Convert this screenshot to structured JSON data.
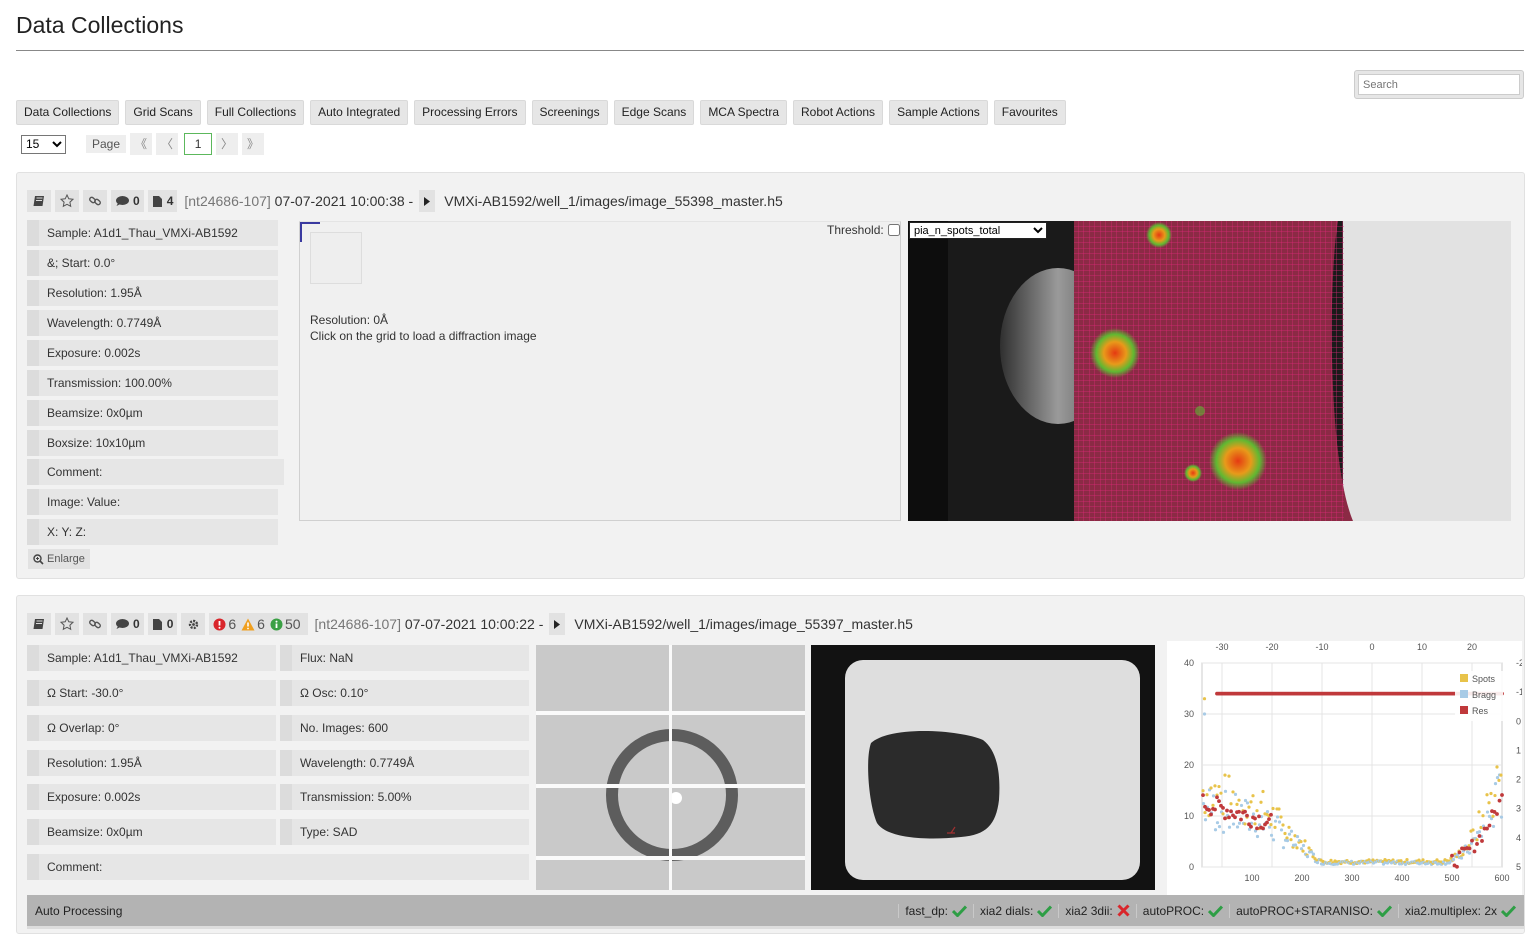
{
  "page": {
    "title": "Data Collections"
  },
  "search": {
    "placeholder": "Search"
  },
  "tabs": [
    "Data Collections",
    "Grid Scans",
    "Full Collections",
    "Auto Integrated",
    "Processing Errors",
    "Screenings",
    "Edge Scans",
    "MCA Spectra",
    "Robot Actions",
    "Sample Actions",
    "Favourites"
  ],
  "pagination": {
    "per_page": "15",
    "label": "Page",
    "first": "《",
    "prev": "〈",
    "current": "1",
    "next": "〉",
    "last": "》"
  },
  "dc1": {
    "comments": "0",
    "attachments": "4",
    "prop": "[nt24686-107]",
    "datetime": "07-07-2021 10:00:38 -",
    "path": "VMXi-AB1592/well_1/images/image_55398_master.h5",
    "fields": [
      "Sample: A1d1_Thau_VMXi-AB1592",
      "&; Start: 0.0°",
      "Resolution: 1.95Å",
      "Wavelength: 0.7749Å",
      "Exposure: 0.002s",
      "Transmission: 100.00%",
      "Beamsize: 0x0µm",
      "Boxsize: 10x10µm",
      "Comment:",
      "Image: Value:",
      "X: Y: Z:"
    ],
    "enlarge": "Enlarge",
    "diff_resolution": "Resolution: 0Å",
    "diff_hint": "Click on the grid to load a diffraction image",
    "threshold_label": "Threshold:",
    "grid_metric": "pia_n_spots_total"
  },
  "dc2": {
    "comments": "0",
    "attachments": "0",
    "errors": "6",
    "warnings": "6",
    "info": "50",
    "prop": "[nt24686-107]",
    "datetime": "07-07-2021 10:00:22 -",
    "path": "VMXi-AB1592/well_1/images/image_55397_master.h5",
    "fields_left": [
      "Sample: A1d1_Thau_VMXi-AB1592",
      "Ω Start: -30.0°",
      "Ω Overlap: 0°",
      "Resolution: 1.95Å",
      "Exposure: 0.002s",
      "Beamsize: 0x0µm",
      "Comment:"
    ],
    "fields_right": [
      "Flux: NaN",
      "Ω Osc: 0.10°",
      "No. Images: 600",
      "Wavelength: 0.7749Å",
      "Transmission: 5.00%",
      "Type: SAD"
    ],
    "auto_processing": {
      "title": "Auto Processing",
      "pipelines": [
        {
          "name": "fast_dp:",
          "status": "ok"
        },
        {
          "name": "xia2 dials:",
          "status": "ok"
        },
        {
          "name": "xia2 3dii:",
          "status": "fail"
        },
        {
          "name": "autoPROC:",
          "status": "ok"
        },
        {
          "name": "autoPROC+STARANISO:",
          "status": "ok"
        },
        {
          "name": "xia2.multiplex: 2x",
          "status": "ok"
        }
      ]
    }
  },
  "chart_data": {
    "type": "scatter",
    "x_top_ticks": [
      "-30",
      "-20",
      "-10",
      "0",
      "10",
      "20"
    ],
    "x_bottom_ticks": [
      "100",
      "200",
      "300",
      "400",
      "500",
      "600"
    ],
    "y_left_ticks": [
      "0",
      "10",
      "20",
      "30",
      "40"
    ],
    "y_right_ticks": [
      "5",
      "4",
      "3",
      "2",
      "1",
      "0",
      "-1",
      "-2"
    ],
    "xlim": [
      0,
      600
    ],
    "ylim": [
      0,
      40
    ],
    "legend_placement": "top-right",
    "series": [
      {
        "name": "Spots",
        "color": "#e8c34a"
      },
      {
        "name": "Bragg",
        "color": "#a8cbe6"
      },
      {
        "name": "Res",
        "color": "#c0393b"
      }
    ]
  },
  "colors": {
    "ok": "#2e9e45",
    "fail": "#d9262b",
    "warning": "#f0a020",
    "info": "#3aa044",
    "grid_line": "#c2185b"
  }
}
